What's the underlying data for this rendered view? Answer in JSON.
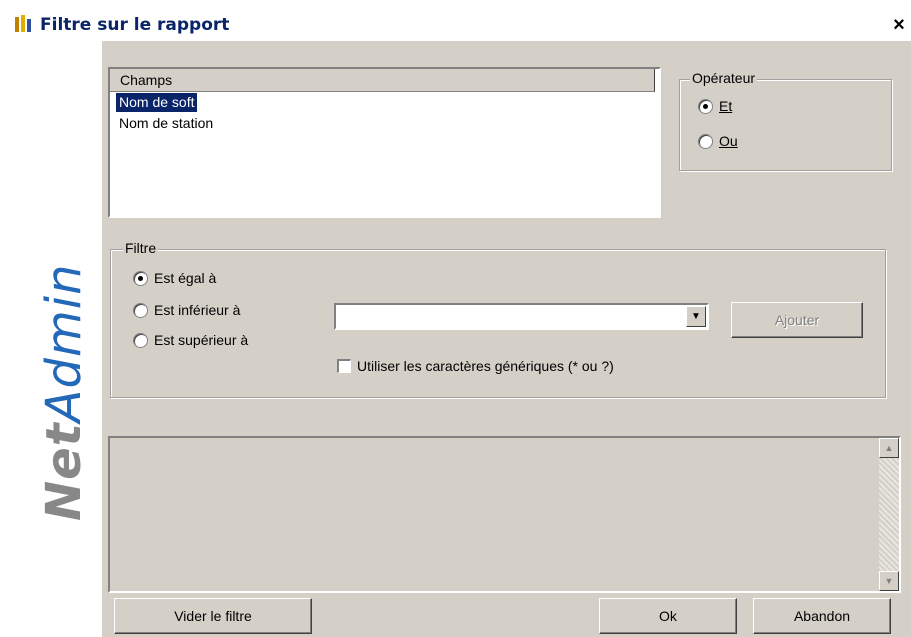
{
  "window": {
    "title": "Filtre sur le rapport",
    "close_symbol": "×"
  },
  "sidebar": {
    "logo_part1": "Net",
    "logo_part2": "Admin"
  },
  "fields": {
    "header": "Champs",
    "items": [
      {
        "label": "Nom de soft",
        "selected": true
      },
      {
        "label": "Nom de station",
        "selected": false
      }
    ]
  },
  "operator": {
    "legend": "Opérateur",
    "options": [
      {
        "label": "Et",
        "checked": true
      },
      {
        "label": "Ou",
        "checked": false
      }
    ]
  },
  "filter": {
    "legend": "Filtre",
    "options": [
      {
        "label": "Est égal à",
        "checked": true
      },
      {
        "label": "Est inférieur à",
        "checked": false
      },
      {
        "label": "Est supérieur à",
        "checked": false
      }
    ],
    "value": "",
    "add_label": "Ajouter",
    "wildcards_label": "Utiliser les caractères génériques (* ou ?)",
    "wildcards_checked": false
  },
  "buttons": {
    "clear": "Vider le filtre",
    "ok": "Ok",
    "cancel": "Abandon"
  }
}
